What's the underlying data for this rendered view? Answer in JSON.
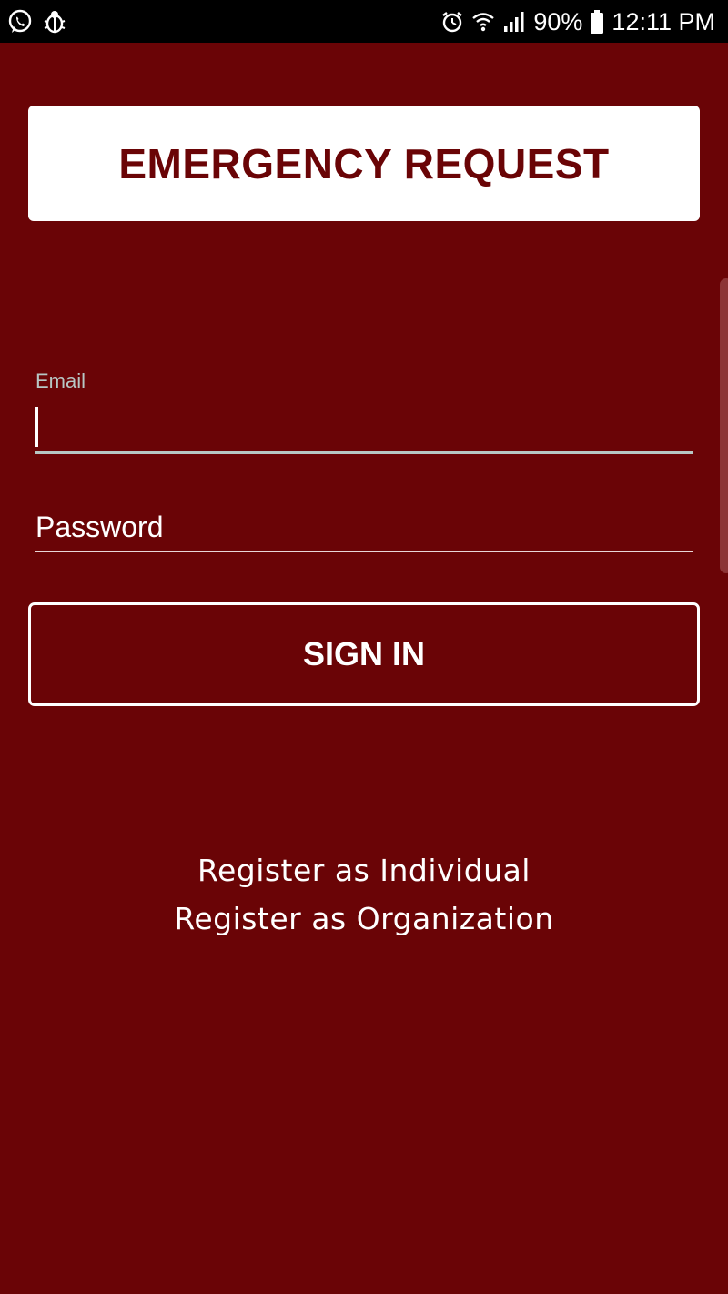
{
  "status_bar": {
    "left_icons": [
      "whatsapp-icon",
      "bug-icon"
    ],
    "right_icons": [
      "alarm-icon",
      "wifi-icon",
      "signal-icon",
      "battery-icon"
    ],
    "battery_percent": "90%",
    "time": "12:11 PM"
  },
  "header": {
    "title": "EMERGENCY REQUEST"
  },
  "login_form": {
    "email_label": "Email",
    "email_value": "",
    "password_placeholder": "Password",
    "password_value": "",
    "sign_in_label": "SIGN IN"
  },
  "register": {
    "individual_label": "Register as Individual",
    "organization_label": "Register as Organization"
  },
  "colors": {
    "background": "#6a0406",
    "title_text": "#6a0406",
    "accent_underline": "#b7c7c4",
    "status_bar": "#000000"
  }
}
